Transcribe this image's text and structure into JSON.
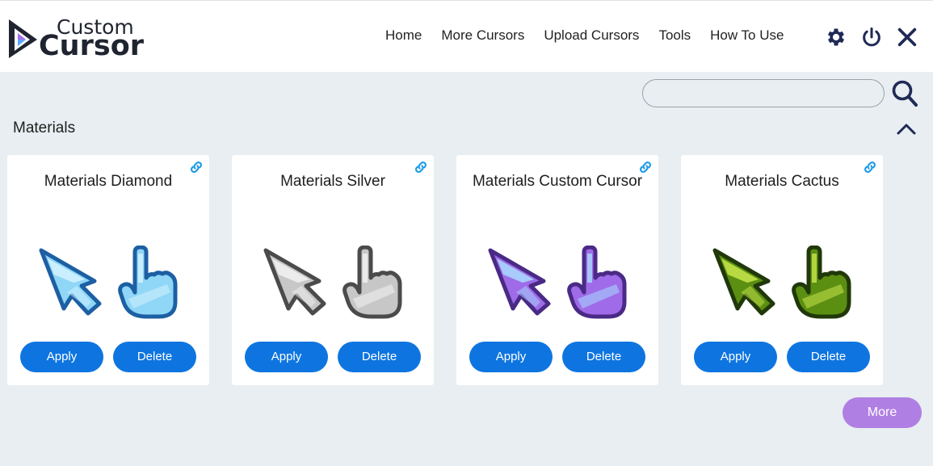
{
  "app": {
    "logo_top": "Custom",
    "logo_bottom": "Cursor"
  },
  "nav": [
    {
      "label": "Home"
    },
    {
      "label": "More Cursors"
    },
    {
      "label": "Upload Cursors"
    },
    {
      "label": "Tools"
    },
    {
      "label": "How To Use"
    }
  ],
  "header_icons": [
    "gear-icon",
    "power-icon",
    "close-icon"
  ],
  "search": {
    "value": "",
    "placeholder": ""
  },
  "section": {
    "title": "Materials"
  },
  "cards": [
    {
      "title": "Materials Diamond",
      "apply": "Apply",
      "delete": "Delete",
      "theme": {
        "fill": "#8fd6f7",
        "light": "#d6f3ff",
        "stroke": "#1d5fa3"
      }
    },
    {
      "title": "Materials Silver",
      "apply": "Apply",
      "delete": "Delete",
      "theme": {
        "fill": "#c7c7c7",
        "light": "#f2f2f2",
        "stroke": "#4b4b4b"
      }
    },
    {
      "title": "Materials Custom Cursor",
      "apply": "Apply",
      "delete": "Delete",
      "theme": {
        "fill": "#9f6be8",
        "light": "#a8dcff",
        "stroke": "#4a2a86"
      }
    },
    {
      "title": "Materials Cactus",
      "apply": "Apply",
      "delete": "Delete",
      "theme": {
        "fill": "#5b8f12",
        "light": "#c8e64a",
        "stroke": "#20380a"
      }
    }
  ],
  "more": {
    "label": "More"
  },
  "colors": {
    "accent": "#0e75e0",
    "more": "#b07fe3",
    "background": "#e8eef1",
    "link_icon": "#1e9be8"
  }
}
